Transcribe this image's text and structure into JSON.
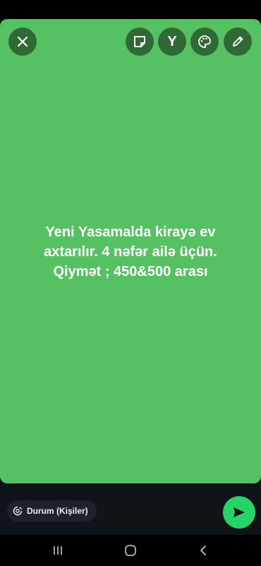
{
  "colors": {
    "canvas_background": "#56c162",
    "send_button": "#25d366",
    "bottom_bar": "#0f1418"
  },
  "toolbar": {
    "close_icon": "close-icon",
    "sticker_icon": "sticker-icon",
    "font_label": "Y",
    "palette_icon": "palette-icon",
    "pencil_icon": "pencil-icon"
  },
  "status": {
    "text": "Yeni Yasamalda kirayə ev\naxtarılır. 4 nəfər ailə üçün.\nQiymət ;  450&500 arası"
  },
  "footer": {
    "audience_label": "Durum (Kişiler)",
    "audience_icon": "status-ring-icon",
    "send_icon": "send-icon"
  },
  "navigation": {
    "recents_icon": "recents-icon",
    "home_icon": "home-icon",
    "back_icon": "back-icon"
  }
}
